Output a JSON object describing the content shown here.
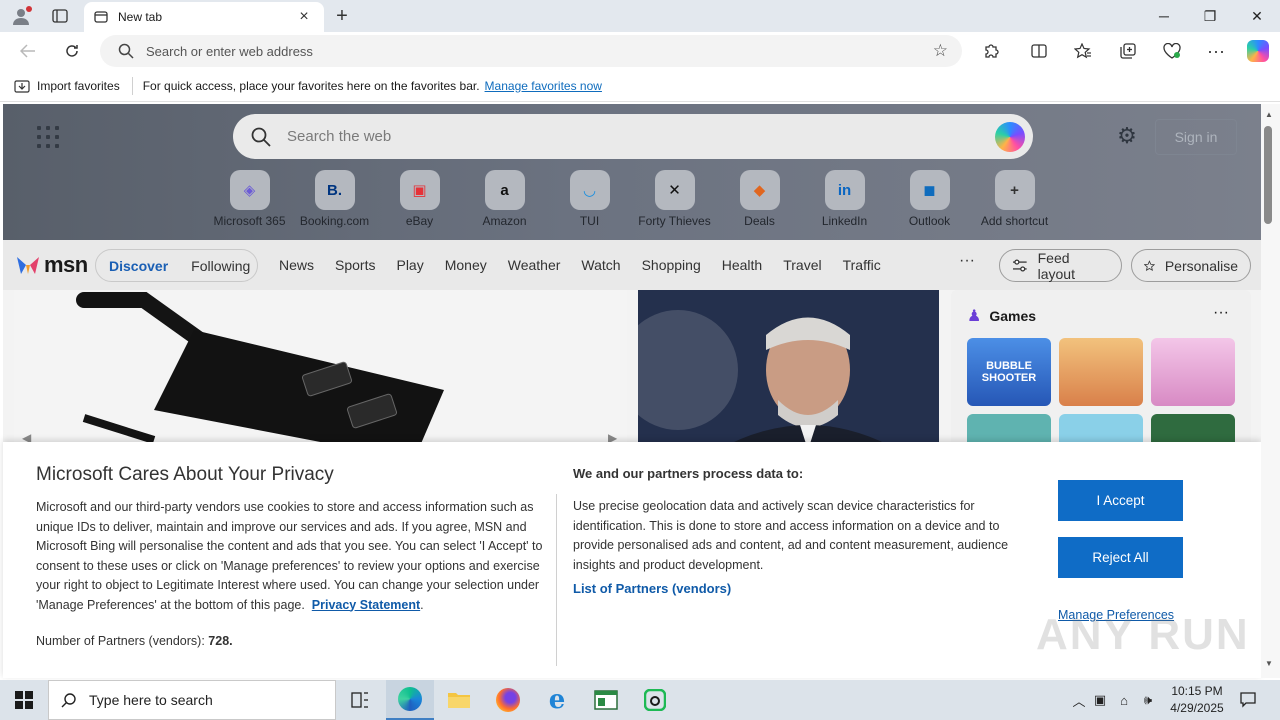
{
  "browser": {
    "tab_title": "New tab",
    "address_placeholder": "Search or enter web address",
    "favorites_bar": {
      "import_label": "Import favorites",
      "hint_text": "For quick access, place your favorites here on the favorites bar.",
      "manage_link": "Manage favorites now"
    }
  },
  "newtab": {
    "search_placeholder": "Search the web",
    "sign_in": "Sign in",
    "shortcuts": [
      {
        "label": "Microsoft 365",
        "glyph": "◈",
        "color": "#6b5bd6"
      },
      {
        "label": "Booking.com",
        "glyph": "B.",
        "color": "#003580"
      },
      {
        "label": "eBay",
        "glyph": "▣",
        "color": "#e53238"
      },
      {
        "label": "Amazon",
        "glyph": "a",
        "color": "#111111"
      },
      {
        "label": "TUI",
        "glyph": "◡",
        "color": "#1a8fe0"
      },
      {
        "label": "Forty Thieves",
        "glyph": "✕",
        "color": "#111111"
      },
      {
        "label": "Deals",
        "glyph": "◆",
        "color": "#e0661f"
      },
      {
        "label": "LinkedIn",
        "glyph": "in",
        "color": "#0a66c2"
      },
      {
        "label": "Outlook",
        "glyph": "◼",
        "color": "#0f6cbd"
      },
      {
        "label": "Add shortcut",
        "glyph": "+",
        "color": "#333333"
      }
    ]
  },
  "msn": {
    "logo_text": "msn",
    "tabs": {
      "discover": "Discover",
      "following": "Following"
    },
    "nav_links": [
      "News",
      "Sports",
      "Play",
      "Money",
      "Weather",
      "Watch",
      "Shopping",
      "Health",
      "Travel",
      "Traffic"
    ],
    "more": "···",
    "feed_layout": "Feed layout",
    "personalise": "Personalise",
    "games_title": "Games",
    "games_more": "···",
    "game_tile_text": "BUBBLE SHOOTER"
  },
  "privacy": {
    "title": "Microsoft Cares About Your Privacy",
    "body": "Microsoft and our third-party vendors use cookies to store and access information such as unique IDs to deliver, maintain and improve our services and ads. If you agree, MSN and Microsoft Bing will personalise the content and ads that you see. You can select 'I Accept' to consent to these uses or click on 'Manage preferences' to review your options and exercise your right to object to Legitimate Interest where used.  You can change your selection under 'Manage Preferences' at the bottom of this page.",
    "privacy_link": "Privacy Statement",
    "partners_count_label": "Number of Partners (vendors):",
    "partners_count": "728.",
    "purposes_heading": "We and our partners process data to:",
    "purposes_text": "Use precise geolocation data and actively scan device characteristics for identification. This is done to store and access information on a device and to provide personalised ads and content, ad and content measurement, audience insights and product development.",
    "partners_link": "List of Partners (vendors)",
    "accept": "I Accept",
    "reject": "Reject All",
    "manage": "Manage Preferences"
  },
  "watermark": "ANY RUN",
  "taskbar": {
    "search_placeholder": "Type here to search",
    "time": "10:15 PM",
    "date": "4/29/2025"
  },
  "colors": {
    "accent": "#0f6cc6",
    "link": "#0f5aa8"
  }
}
